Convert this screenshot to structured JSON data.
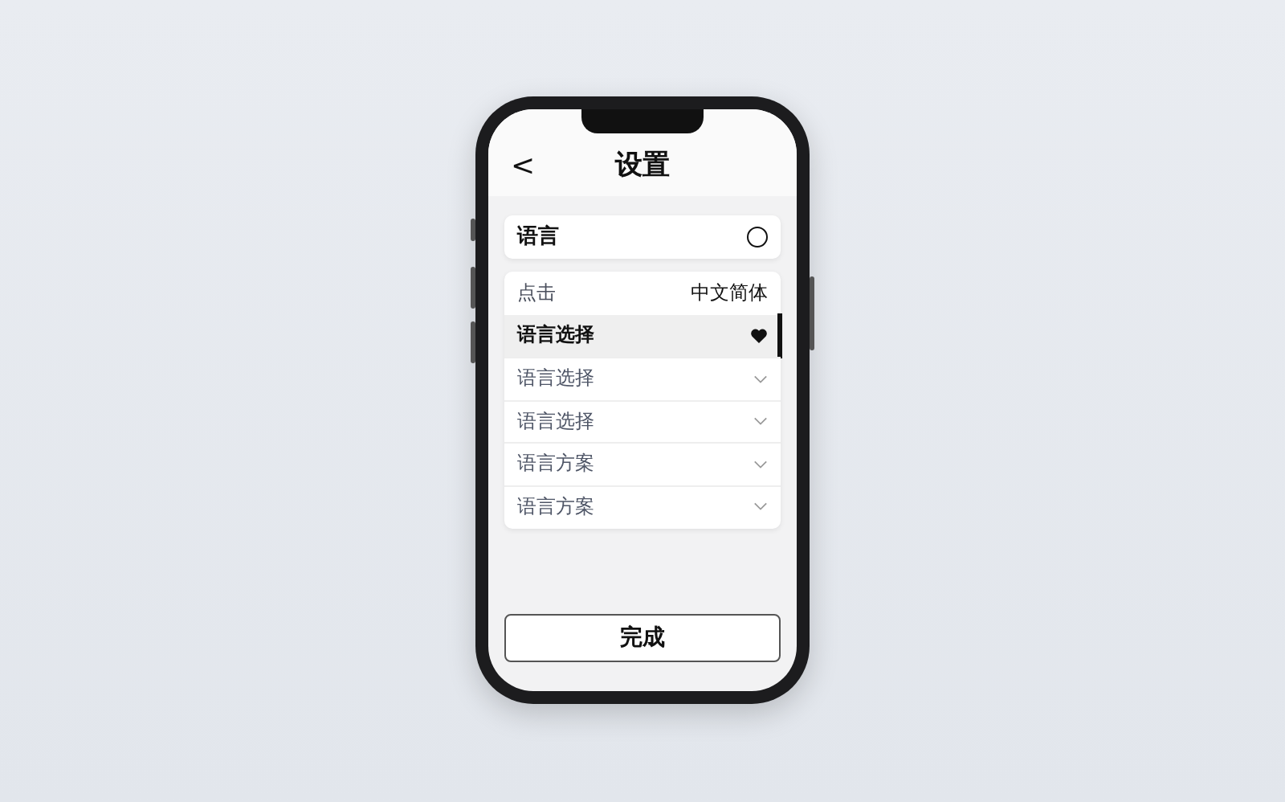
{
  "header": {
    "back": "<",
    "title": "设置"
  },
  "language_card": {
    "label": "语言",
    "checked": false
  },
  "list": {
    "header": {
      "label": "点击",
      "value": "中文简体"
    },
    "items": [
      {
        "label": "语言选择",
        "selected": true
      },
      {
        "label": "语言选择",
        "selected": false
      },
      {
        "label": "语言选择",
        "selected": false
      },
      {
        "label": "语言方案",
        "selected": false
      },
      {
        "label": "语言方案",
        "selected": false
      }
    ]
  },
  "done_button": "完成"
}
